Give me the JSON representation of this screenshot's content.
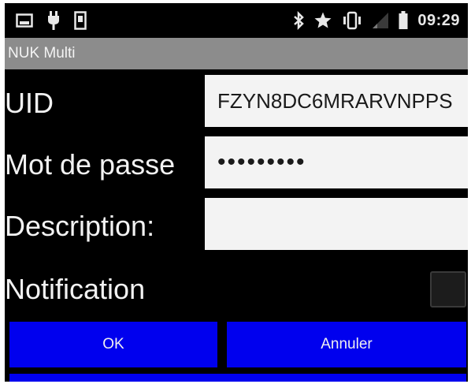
{
  "status_bar": {
    "time": "09:29",
    "left_icons": [
      "image-icon",
      "plug-icon",
      "phone-icon"
    ],
    "right_icons": [
      "bluetooth-icon",
      "star-icon",
      "vibrate-icon",
      "signal-icon",
      "battery-icon"
    ]
  },
  "app": {
    "title": "NUK Multi"
  },
  "form": {
    "uid_label": "UID",
    "uid_value": "FZYN8DC6MRARVNPPS",
    "password_label": "Mot de passe",
    "password_value": "•••••••••",
    "description_label": "Description:",
    "description_value": "",
    "notification_label": "Notification"
  },
  "buttons": {
    "ok_label": "OK",
    "cancel_label": "Annuler"
  },
  "colors": {
    "button_blue": "#0000ee",
    "titlebar_gray": "#8c8c8c",
    "background": "#000000",
    "field_bg": "#f3f3f3"
  }
}
